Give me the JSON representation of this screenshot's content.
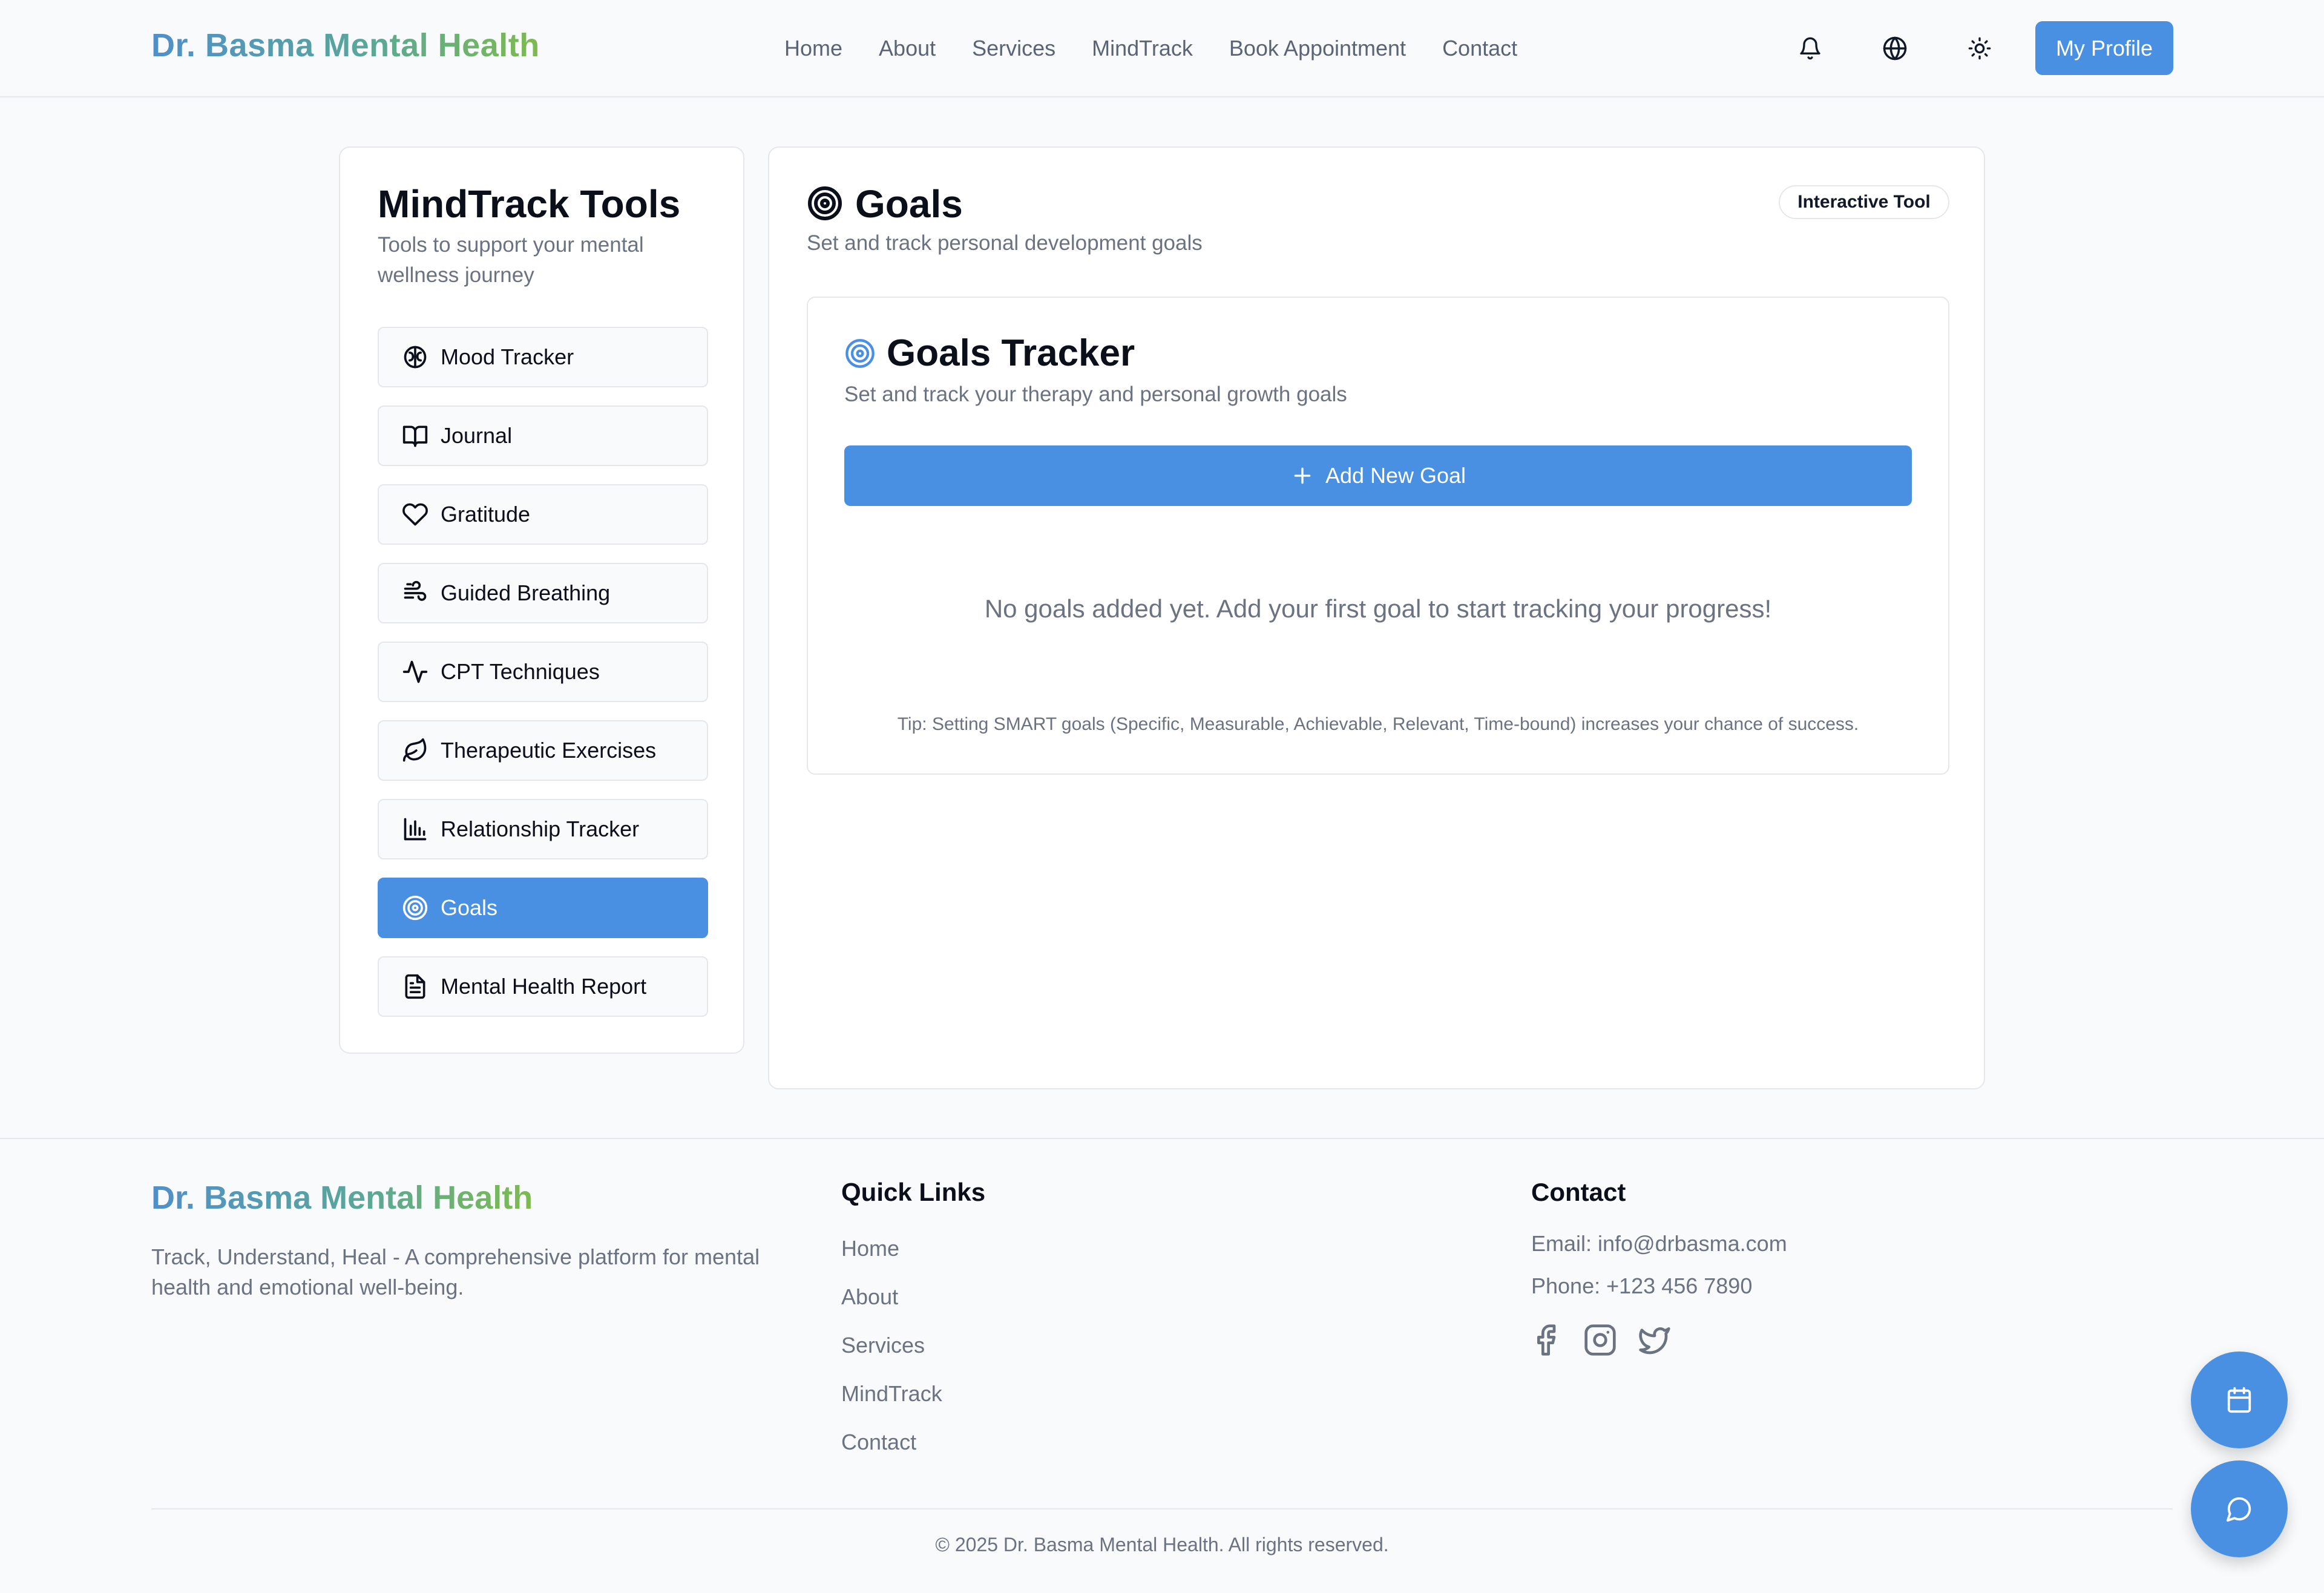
{
  "header": {
    "brand": "Dr. Basma Mental Health",
    "nav": [
      "Home",
      "About",
      "Services",
      "MindTrack",
      "Book Appointment",
      "Contact"
    ],
    "icons": [
      "bell-icon",
      "globe-icon",
      "sun-icon"
    ],
    "profile_label": "My Profile"
  },
  "sidebar": {
    "title": "MindTrack Tools",
    "subtitle": "Tools to support your mental wellness journey",
    "items": [
      {
        "label": "Mood Tracker",
        "icon": "brain-icon"
      },
      {
        "label": "Journal",
        "icon": "book-icon"
      },
      {
        "label": "Gratitude",
        "icon": "heart-icon"
      },
      {
        "label": "Guided Breathing",
        "icon": "wind-icon"
      },
      {
        "label": "CPT Techniques",
        "icon": "activity-icon"
      },
      {
        "label": "Therapeutic Exercises",
        "icon": "leaf-icon"
      },
      {
        "label": "Relationship Tracker",
        "icon": "bar-chart-icon"
      },
      {
        "label": "Goals",
        "icon": "target-icon",
        "active": true
      },
      {
        "label": "Mental Health Report",
        "icon": "file-text-icon"
      }
    ]
  },
  "main": {
    "title": "Goals",
    "subtitle": "Set and track personal development goals",
    "badge": "Interactive Tool",
    "tracker": {
      "title": "Goals Tracker",
      "subtitle": "Set and track your therapy and personal growth goals",
      "add_label": "Add New Goal",
      "empty_text": "No goals added yet. Add your first goal to start tracking your progress!",
      "tip": "Tip: Setting SMART goals (Specific, Measurable, Achievable, Relevant, Time-bound) increases your chance of success."
    }
  },
  "footer": {
    "brand": "Dr. Basma Mental Health",
    "description": "Track, Understand, Heal - A comprehensive platform for mental health and emotional well-being.",
    "quick_links_title": "Quick Links",
    "quick_links": [
      "Home",
      "About",
      "Services",
      "MindTrack",
      "Contact"
    ],
    "contact_title": "Contact",
    "email": "Email: info@drbasma.com",
    "phone": "Phone: +123 456 7890",
    "social_icons": [
      "facebook-icon",
      "instagram-icon",
      "twitter-icon"
    ],
    "copyright": "© 2025 Dr. Basma Mental Health. All rights reserved."
  },
  "floating": [
    "calendar-icon",
    "chat-icon"
  ],
  "colors": {
    "accent": "#4a90e2",
    "brand_gradient": [
      "#4f90c9",
      "#5aa69a",
      "#7dbb4f"
    ],
    "muted_text": "#6b7280",
    "border": "#e5e7eb",
    "background": "#f8fafc"
  }
}
